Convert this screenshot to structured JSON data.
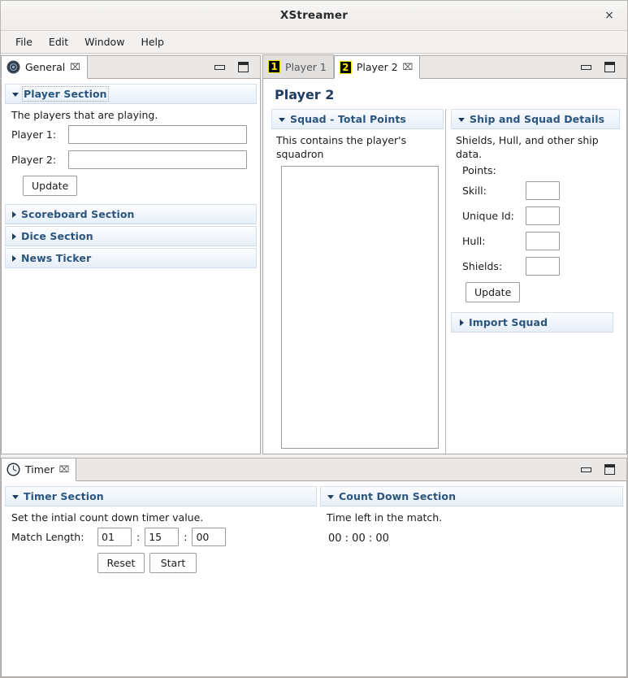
{
  "window": {
    "title": "XStreamer",
    "close_label": "×"
  },
  "menubar": {
    "items": [
      {
        "label": "File"
      },
      {
        "label": "Edit"
      },
      {
        "label": "Window"
      },
      {
        "label": "Help"
      }
    ]
  },
  "general_part": {
    "tab": {
      "label": "General",
      "icon": "gear-icon",
      "close_label": "⌧"
    },
    "minimize_icon": "minimize-icon",
    "maximize_icon": "maximize-icon",
    "sections": [
      {
        "title": "Player Section",
        "expanded": true,
        "description": "The players that are playing.",
        "fields": [
          {
            "label": "Player 1:",
            "value": "",
            "placeholder": ""
          },
          {
            "label": "Player 2:",
            "value": "",
            "placeholder": ""
          }
        ],
        "button": "Update"
      },
      {
        "title": "Scoreboard Section",
        "expanded": false
      },
      {
        "title": "Dice Section",
        "expanded": false
      },
      {
        "title": "News Ticker",
        "expanded": false
      }
    ]
  },
  "player_part": {
    "tabs": [
      {
        "label": "Player 1",
        "icon": "number-1-icon",
        "active": false,
        "closeable": false
      },
      {
        "label": "Player 2",
        "icon": "number-2-icon",
        "active": true,
        "closeable": true,
        "close_label": "⌧"
      }
    ],
    "minimize_icon": "minimize-icon",
    "maximize_icon": "maximize-icon",
    "heading": "Player 2",
    "squad_section": {
      "title": "Squad - Total Points",
      "expanded": true,
      "description": "This contains the player's squadron",
      "list_items": []
    },
    "details_section": {
      "title": "Ship and Squad Details",
      "expanded": true,
      "description": "Shields, Hull, and other ship data.",
      "points_label": "Points:",
      "fields": [
        {
          "label": "Skill:",
          "value": ""
        },
        {
          "label": "Unique Id:",
          "value": ""
        },
        {
          "label": "Hull:",
          "value": ""
        },
        {
          "label": "Shields:",
          "value": ""
        }
      ],
      "button": "Update"
    },
    "import_section": {
      "title": "Import Squad",
      "expanded": false
    }
  },
  "timer_part": {
    "tab": {
      "label": "Timer",
      "icon": "clock-icon",
      "close_label": "⌧"
    },
    "minimize_icon": "minimize-icon",
    "maximize_icon": "maximize-icon",
    "timer_section": {
      "title": "Timer Section",
      "expanded": true,
      "description": "Set the intial count down timer value.",
      "match_length_label": "Match Length:",
      "hours": "01",
      "minutes": "15",
      "seconds": "00",
      "separator": ":",
      "reset_button": "Reset",
      "start_button": "Start"
    },
    "countdown_section": {
      "title": "Count Down Section",
      "expanded": true,
      "description": "Time left in the match.",
      "value": "00 : 00 : 00"
    }
  },
  "colors": {
    "section_title": "#2a5580",
    "heading": "#1f3c63",
    "tab_icon_bg": "#000000",
    "tab_icon_fg": "#ffe600",
    "window_bg": "#f2f1f0"
  }
}
